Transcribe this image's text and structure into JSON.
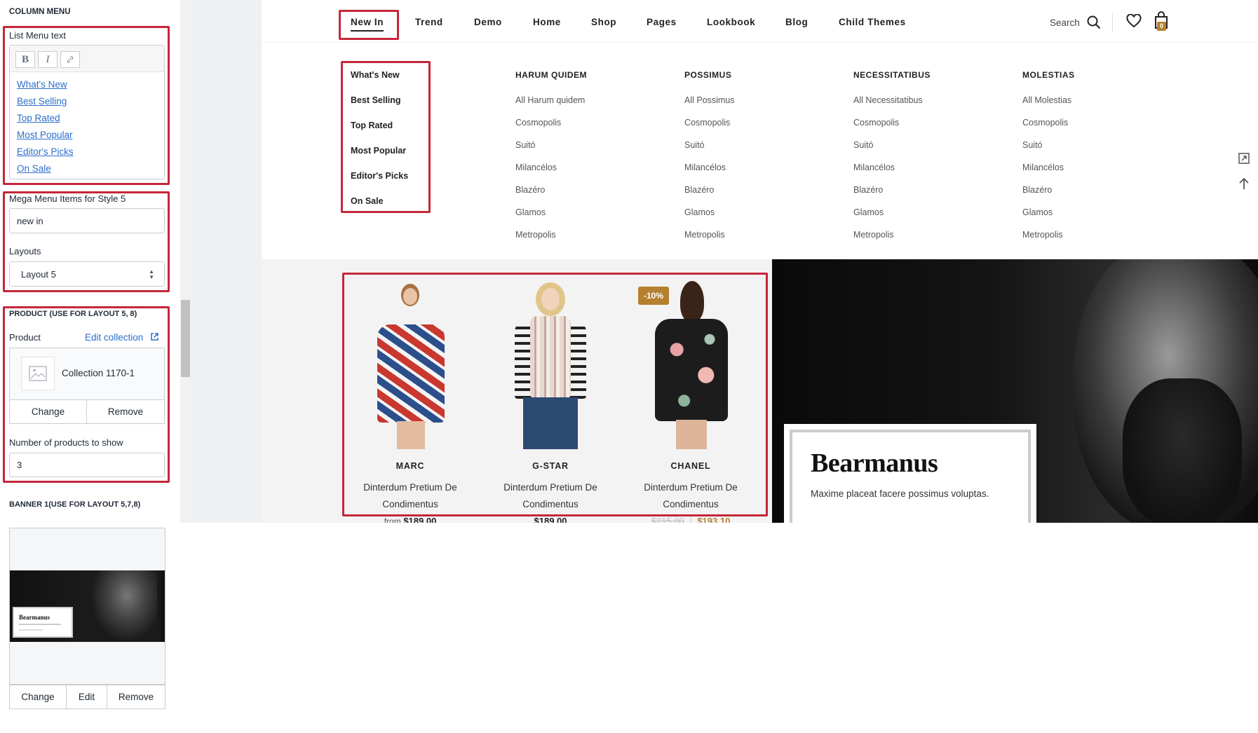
{
  "column_menu": {
    "title": "COLUMN MENU",
    "list_menu_text_label": "List Menu text",
    "rte_buttons": [
      "B",
      "I"
    ],
    "links": [
      "What's New",
      "Best Selling",
      "Top Rated",
      "Most Popular",
      "Editor's Picks",
      "On Sale"
    ],
    "mega_items_label": "Mega Menu Items for Style 5",
    "mega_items_value": "new in",
    "layouts_label": "Layouts",
    "layouts_value": "Layout 5"
  },
  "product_section": {
    "title": "PRODUCT (USE FOR LAYOUT 5, 8)",
    "product_label": "Product",
    "edit_collection": "Edit collection",
    "collection_name": "Collection 1170-1",
    "change": "Change",
    "remove": "Remove",
    "count_label": "Number of products to show",
    "count_value": "3"
  },
  "banner_section": {
    "title": "BANNER 1(USE FOR LAYOUT 5,7,8)",
    "thumb_text": "Bearmanus",
    "change": "Change",
    "edit": "Edit",
    "remove": "Remove"
  },
  "store_nav": {
    "items": [
      "New In",
      "Trend",
      "Demo",
      "Home",
      "Shop",
      "Pages",
      "Lookbook",
      "Blog",
      "Child Themes"
    ],
    "search_label": "Search",
    "cart_count": "0"
  },
  "mega_menu": {
    "left_links": [
      "What's New",
      "Best Selling",
      "Top Rated",
      "Most Popular",
      "Editor's Picks",
      "On Sale"
    ],
    "columns": [
      {
        "heading": "HARUM QUIDEM",
        "links": [
          "All Harum quidem",
          "Cosmopolis",
          "Suitó",
          "Milancélos",
          "Blazéro",
          "Glamos",
          "Metropolis"
        ]
      },
      {
        "heading": "POSSIMUS",
        "links": [
          "All Possimus",
          "Cosmopolis",
          "Suitó",
          "Milancélos",
          "Blazéro",
          "Glamos",
          "Metropolis"
        ]
      },
      {
        "heading": "NECESSITATIBUS",
        "links": [
          "All Necessitatibus",
          "Cosmopolis",
          "Suitó",
          "Milancélos",
          "Blazéro",
          "Glamos",
          "Metropolis"
        ]
      },
      {
        "heading": "MOLESTIAS",
        "links": [
          "All Molestias",
          "Cosmopolis",
          "Suitó",
          "Milancélos",
          "Blazéro",
          "Glamos",
          "Metropolis"
        ]
      }
    ]
  },
  "products": [
    {
      "brand": "MARC",
      "name": "Dinterdum Pretium De Condimentus",
      "price_prefix": "from",
      "price": "$189.00"
    },
    {
      "brand": "G-STAR",
      "name": "Dinterdum Pretium De Condimentus",
      "price": "$189.00"
    },
    {
      "brand": "CHANEL",
      "name": "Dinterdum Pretium De Condimentus",
      "badge": "-10%",
      "old_price": "$215.00",
      "price": "$193.10"
    }
  ],
  "banner": {
    "title": "Bearmanus",
    "subtitle": "Maxime placeat facere possimus voluptas."
  },
  "colors": {
    "highlight": "#c4273a",
    "accent": "#b5802f",
    "link": "#2c6ecb"
  }
}
